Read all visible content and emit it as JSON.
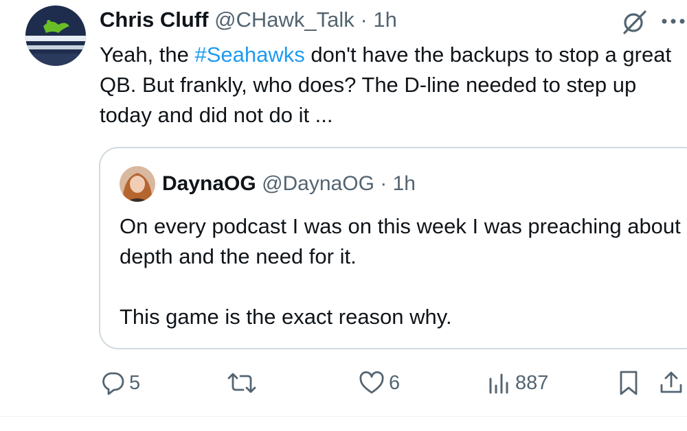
{
  "tweet": {
    "author_name": "Chris Cluff",
    "author_handle": "@CHawk_Talk",
    "separator": "·",
    "time": "1h",
    "text_before_hashtag": "Yeah, the ",
    "hashtag": "#Seahawks",
    "text_after_hashtag": " don't have the backups to stop a great QB. But frankly, who does? The D-line needed to step up today and did not do it ..."
  },
  "quote": {
    "author_name": "DaynaOG",
    "author_handle": "@DaynaOG",
    "separator": "·",
    "time": "1h",
    "paragraph1": "On every podcast I was on this week I was preaching about depth and the need for it.",
    "paragraph2": "This game is the exact reason why."
  },
  "actions": {
    "replies": "5",
    "retweets": "",
    "likes": "6",
    "views": "887"
  },
  "colors": {
    "hashtag": "#1d9bf0",
    "muted": "#536471",
    "border": "#cfd9de"
  },
  "icons": [
    "grok-icon",
    "more-icon",
    "reply-icon",
    "retweet-icon",
    "like-icon",
    "views-icon",
    "bookmark-icon",
    "share-icon"
  ]
}
